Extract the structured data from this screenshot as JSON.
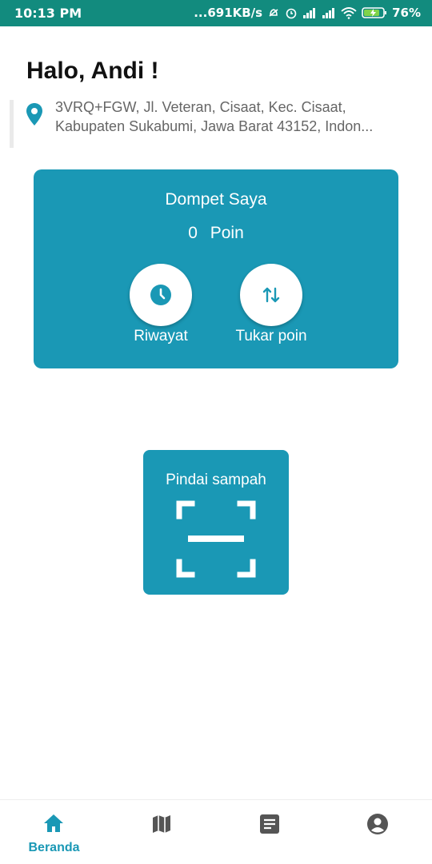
{
  "status_bar": {
    "time": "10:13 PM",
    "network_speed": "...691KB/s",
    "battery": "76%",
    "icons": [
      "do-not-disturb-off-icon",
      "alarm-icon",
      "signal-icon",
      "signal-icon",
      "wifi-icon",
      "battery-charging-icon"
    ]
  },
  "header": {
    "greeting": "Halo, Andi !",
    "address_line1": "3VRQ+FGW, Jl. Veteran, Cisaat, Kec. Cisaat,",
    "address_line2": "Kabupaten Sukabumi, Jawa Barat 43152, Indon...",
    "location_icon": "location-pin-icon"
  },
  "wallet": {
    "title": "Dompet Saya",
    "points_value": "0",
    "points_unit": "Poin",
    "history_label": "Riwayat",
    "history_icon": "clock-icon",
    "exchange_label": "Tukar poin",
    "exchange_icon": "swap-vertical-icon"
  },
  "scan": {
    "label": "Pindai sampah",
    "icon": "scan-frame-icon"
  },
  "bottom_nav": {
    "items": [
      {
        "label": "Beranda",
        "icon": "home-icon",
        "active": true
      },
      {
        "label": "",
        "icon": "map-icon",
        "active": false
      },
      {
        "label": "",
        "icon": "document-icon",
        "active": false
      },
      {
        "label": "",
        "icon": "account-icon",
        "active": false
      }
    ]
  },
  "colors": {
    "status_bar": "#128b7e",
    "primary": "#1a98b5",
    "text_dark": "#111111",
    "text_muted": "#666666",
    "nav_inactive": "#555555"
  }
}
